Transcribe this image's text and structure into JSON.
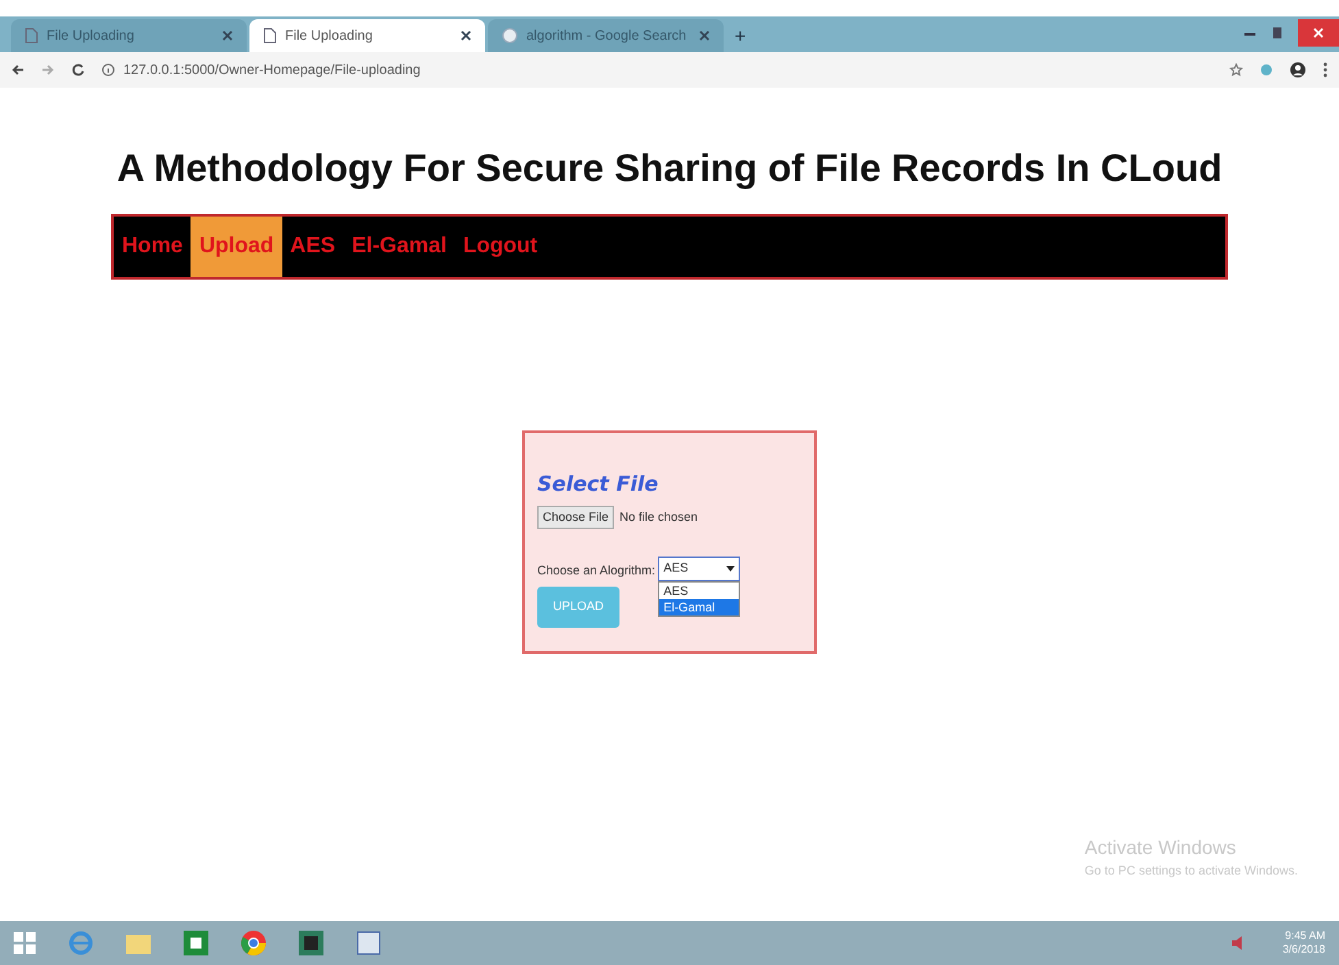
{
  "browser": {
    "tabs": [
      {
        "title": "File Uploading",
        "selected": false,
        "kind": "page"
      },
      {
        "title": "File Uploading",
        "selected": true,
        "kind": "page"
      },
      {
        "title": "algorithm - Google Search",
        "selected": false,
        "kind": "google"
      }
    ],
    "new_tab": "+",
    "url": "127.0.0.1:5000/Owner-Homepage/File-uploading"
  },
  "page": {
    "title": "A Methodology For Secure Sharing of File Records In CLoud",
    "nav": [
      {
        "label": "Home",
        "selected": false
      },
      {
        "label": "Upload",
        "selected": true
      },
      {
        "label": "AES",
        "selected": false
      },
      {
        "label": "El-Gamal",
        "selected": false
      },
      {
        "label": "Logout",
        "selected": false
      }
    ],
    "form": {
      "heading": "Select File",
      "file_button": "Choose File",
      "file_status": "No file chosen",
      "algorithm_label": "Choose an Alogrithm:",
      "algorithm_value": "AES",
      "options": [
        {
          "label": "AES",
          "selected": false
        },
        {
          "label": "El-Gamal",
          "selected": true
        }
      ],
      "upload_button": "UPLOAD"
    }
  },
  "activation": {
    "title": "Activate Windows",
    "message": "Go to PC settings to activate Windows."
  },
  "taskbar": {
    "time": "9:45 AM",
    "date": "3/6/2018"
  }
}
